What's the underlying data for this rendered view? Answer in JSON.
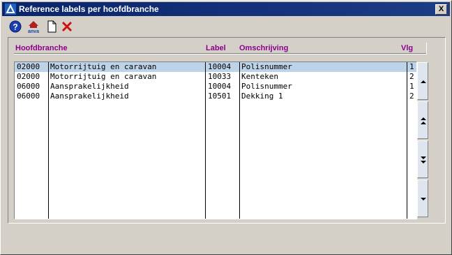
{
  "window": {
    "title": "Reference labels per hoofdbranche",
    "close_label": "X"
  },
  "toolbar": {
    "items": [
      "help-icon",
      "anva-icon",
      "new-document-icon",
      "delete-icon"
    ],
    "anva_text": "anva"
  },
  "table": {
    "headers": {
      "hoofdbranche": "Hoofdbranche",
      "label": "Label",
      "omschrijving": "Omschrijving",
      "vlg": "Vlg"
    },
    "rows": [
      {
        "code": "02000",
        "name": "Motorrijtuig en caravan",
        "label": "10004",
        "omschrijving": "Polisnummer",
        "vlg": "1",
        "selected": true
      },
      {
        "code": "02000",
        "name": "Motorrijtuig en caravan",
        "label": "10033",
        "omschrijving": "Kenteken",
        "vlg": "2",
        "selected": false
      },
      {
        "code": "06000",
        "name": "Aansprakelijkheid",
        "label": "10004",
        "omschrijving": "Polisnummer",
        "vlg": "1",
        "selected": false
      },
      {
        "code": "06000",
        "name": "Aansprakelijkheid",
        "label": "10501",
        "omschrijving": "Dekking  1",
        "vlg": "2",
        "selected": false
      }
    ]
  },
  "colors": {
    "header_text": "#8b008b",
    "title_bar": "#0a246a",
    "selected_row": "#bdd3ea"
  }
}
